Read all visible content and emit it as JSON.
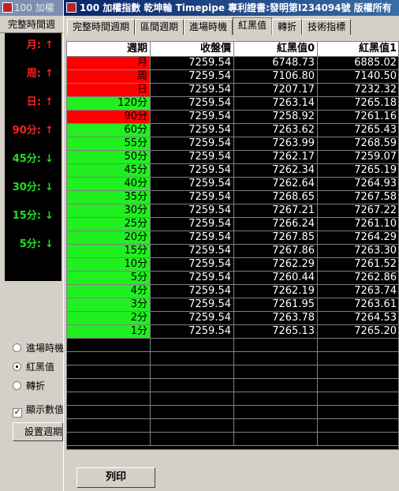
{
  "back_window": {
    "title": "100 加權",
    "tab": "完整時間週",
    "indicators": [
      {
        "label": "月:",
        "arrow": "↑",
        "color": "red"
      },
      {
        "label": "周:",
        "arrow": "↑",
        "color": "red"
      },
      {
        "label": "日:",
        "arrow": "↑",
        "color": "red"
      },
      {
        "label": "90分:",
        "arrow": "↑",
        "color": "red"
      },
      {
        "label": "45分:",
        "arrow": "↓",
        "color": "green"
      },
      {
        "label": "30分:",
        "arrow": "↓",
        "color": "green"
      },
      {
        "label": "15分:",
        "arrow": "↓",
        "color": "green"
      },
      {
        "label": "5分:",
        "arrow": "↓",
        "color": "green"
      }
    ],
    "options": [
      {
        "label": "進場時機",
        "selected": false
      },
      {
        "label": "紅黑值",
        "selected": true
      },
      {
        "label": "轉折",
        "selected": false
      }
    ],
    "checkbox_label": "顯示數值",
    "checkbox_checked": true,
    "setting_button": "設置週期"
  },
  "window": {
    "title": "100 加權指數  乾坤輪 Timepipe 專利證書:發明第I234094號 版權所有"
  },
  "tabs": [
    {
      "label": "完整時間週期",
      "active": false
    },
    {
      "label": "區間週期",
      "active": false
    },
    {
      "label": "進場時機",
      "active": false
    },
    {
      "label": "紅黑值",
      "active": true
    },
    {
      "label": "轉折",
      "active": false
    },
    {
      "label": "技術指標",
      "active": false
    }
  ],
  "table": {
    "headers": [
      "週期",
      "收盤價",
      "紅黑值0",
      "紅黑值1"
    ],
    "rows": [
      {
        "period": "月",
        "color": "red",
        "close": "7259.54",
        "rb0": "6748.73",
        "rb1": "6885.02"
      },
      {
        "period": "周",
        "color": "red",
        "close": "7259.54",
        "rb0": "7106.80",
        "rb1": "7140.50"
      },
      {
        "period": "日",
        "color": "red",
        "close": "7259.54",
        "rb0": "7207.17",
        "rb1": "7232.32"
      },
      {
        "period": "120分",
        "color": "green",
        "close": "7259.54",
        "rb0": "7263.14",
        "rb1": "7265.18"
      },
      {
        "period": "90分",
        "color": "red",
        "close": "7259.54",
        "rb0": "7258.92",
        "rb1": "7261.16"
      },
      {
        "period": "60分",
        "color": "green",
        "close": "7259.54",
        "rb0": "7263.62",
        "rb1": "7265.43"
      },
      {
        "period": "55分",
        "color": "green",
        "close": "7259.54",
        "rb0": "7263.99",
        "rb1": "7268.59"
      },
      {
        "period": "50分",
        "color": "green",
        "close": "7259.54",
        "rb0": "7262.17",
        "rb1": "7259.07"
      },
      {
        "period": "45分",
        "color": "green",
        "close": "7259.54",
        "rb0": "7262.34",
        "rb1": "7265.19"
      },
      {
        "period": "40分",
        "color": "green",
        "close": "7259.54",
        "rb0": "7262.64",
        "rb1": "7264.93"
      },
      {
        "period": "35分",
        "color": "green",
        "close": "7259.54",
        "rb0": "7268.65",
        "rb1": "7267.58"
      },
      {
        "period": "30分",
        "color": "green",
        "close": "7259.54",
        "rb0": "7267.21",
        "rb1": "7267.22"
      },
      {
        "period": "25分",
        "color": "green",
        "close": "7259.54",
        "rb0": "7266.24",
        "rb1": "7261.10"
      },
      {
        "period": "20分",
        "color": "green",
        "close": "7259.54",
        "rb0": "7267.85",
        "rb1": "7264.29"
      },
      {
        "period": "15分",
        "color": "green",
        "close": "7259.54",
        "rb0": "7267.86",
        "rb1": "7263.30"
      },
      {
        "period": "10分",
        "color": "green",
        "close": "7259.54",
        "rb0": "7262.29",
        "rb1": "7261.52"
      },
      {
        "period": "5分",
        "color": "green",
        "close": "7259.54",
        "rb0": "7260.44",
        "rb1": "7262.86"
      },
      {
        "period": "4分",
        "color": "green",
        "close": "7259.54",
        "rb0": "7262.19",
        "rb1": "7263.74"
      },
      {
        "period": "3分",
        "color": "green",
        "close": "7259.54",
        "rb0": "7261.95",
        "rb1": "7263.61"
      },
      {
        "period": "2分",
        "color": "green",
        "close": "7259.54",
        "rb0": "7263.78",
        "rb1": "7264.53"
      },
      {
        "period": "1分",
        "color": "green",
        "close": "7259.54",
        "rb0": "7265.13",
        "rb1": "7265.20"
      }
    ]
  },
  "print_button": "列印",
  "colors": {
    "up": "#ff0000",
    "down": "#20f020"
  }
}
